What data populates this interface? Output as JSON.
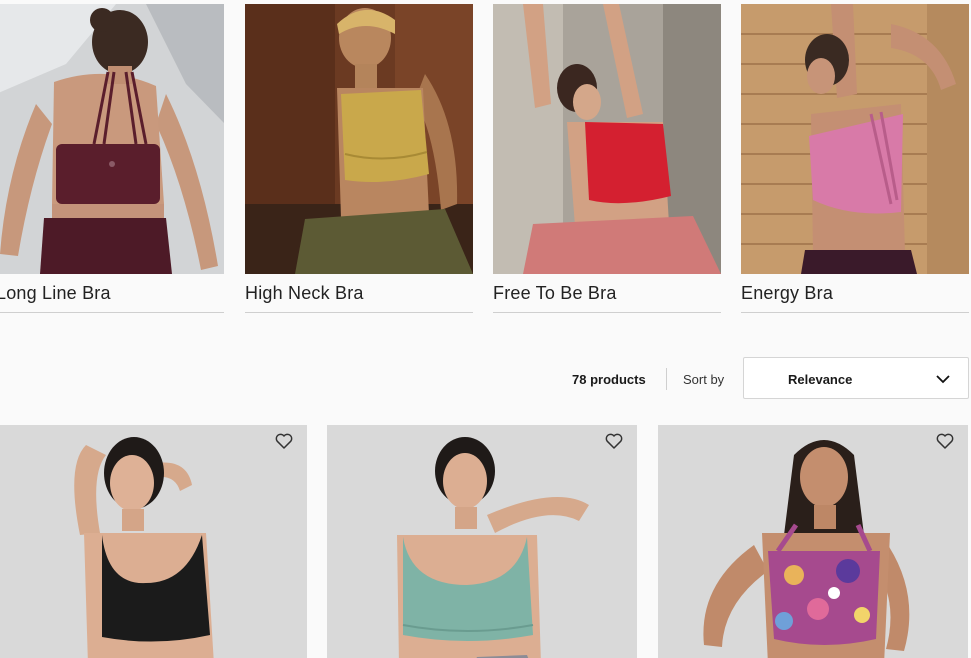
{
  "categories": [
    {
      "label": "Long Line Bra"
    },
    {
      "label": "High Neck Bra"
    },
    {
      "label": "Free To Be Bra"
    },
    {
      "label": "Energy Bra"
    }
  ],
  "toolbar": {
    "count": "78 products",
    "sort_label": "Sort by",
    "sort_value": "Relevance"
  },
  "icons": {
    "wishlist": "heart-icon",
    "dropdown": "chevron-down-icon"
  },
  "colors": {
    "bra_maroon": "#5a1e2c",
    "bra_mustard": "#c9a84b",
    "bra_red": "#d42030",
    "bra_pink": "#d87aa8",
    "bra_black": "#1b1b1b",
    "bra_teal": "#7fb3a6"
  }
}
